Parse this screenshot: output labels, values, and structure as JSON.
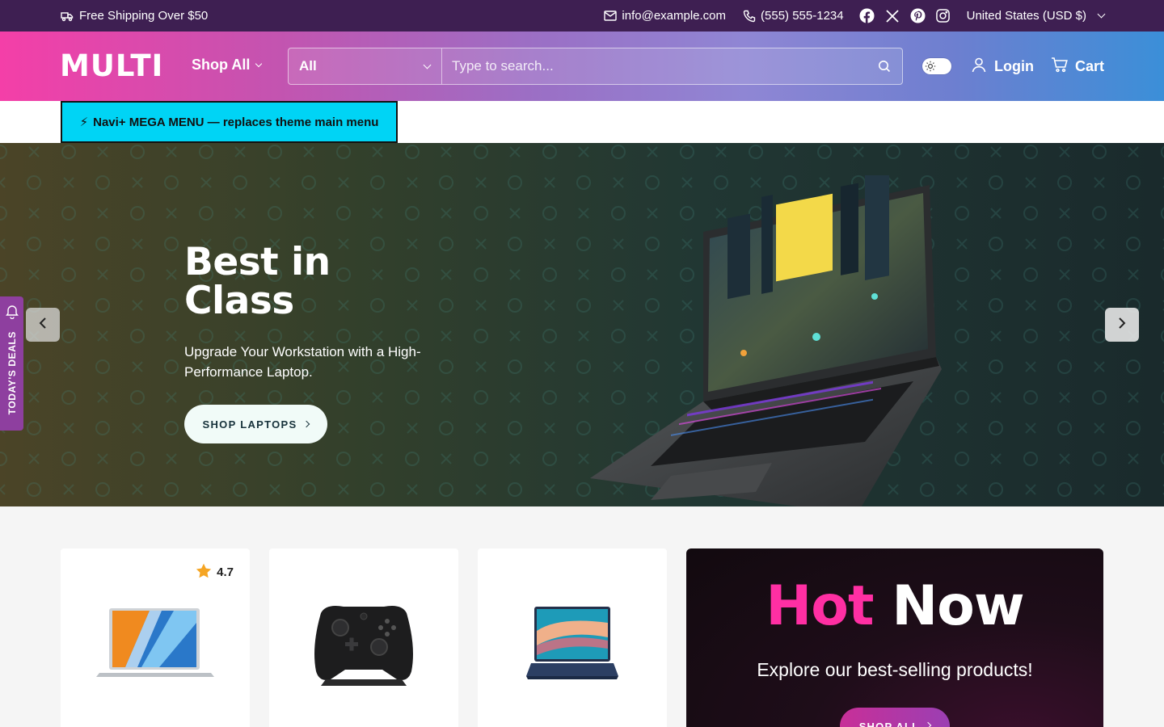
{
  "topbar": {
    "shipping": "Free Shipping Over $50",
    "email": "info@example.com",
    "phone": "(555) 555-1234",
    "socials": [
      "facebook-icon",
      "x-icon",
      "pinterest-icon",
      "instagram-icon"
    ],
    "country": "United States (USD $)"
  },
  "header": {
    "logo": "MULTI",
    "shop_all": "Shop All",
    "search_category": "All",
    "search_placeholder": "Type to search...",
    "login": "Login",
    "cart": "Cart"
  },
  "mega_menu": {
    "label": "Navi+ MEGA MENU — replaces theme main menu",
    "icon": "⚡"
  },
  "hero": {
    "title_line1": "Best in",
    "title_line2": "Class",
    "subtitle": "Upgrade Your Workstation with a High-Performance Laptop.",
    "cta": "SHOP LAPTOPS"
  },
  "deals_tab": {
    "label": "TODAY'S DEALS"
  },
  "products": [
    {
      "rating": "4.7",
      "image": "silver-laptop"
    },
    {
      "image": "game-controller"
    },
    {
      "image": "blue-laptop"
    }
  ],
  "promo": {
    "title_hot": "Hot",
    "title_now": "Now",
    "subtitle": "Explore our best-selling products!",
    "cta": "SHOP ALL"
  },
  "colors": {
    "topbar_bg": "#3e1f52",
    "header_gradient_start": "#f43fa8",
    "header_gradient_end": "#3b8fd8",
    "mega_menu_bg": "#00d4f5",
    "deals_tab_bg": "#8e3f9f",
    "hot_accent": "#ff2fa3"
  }
}
